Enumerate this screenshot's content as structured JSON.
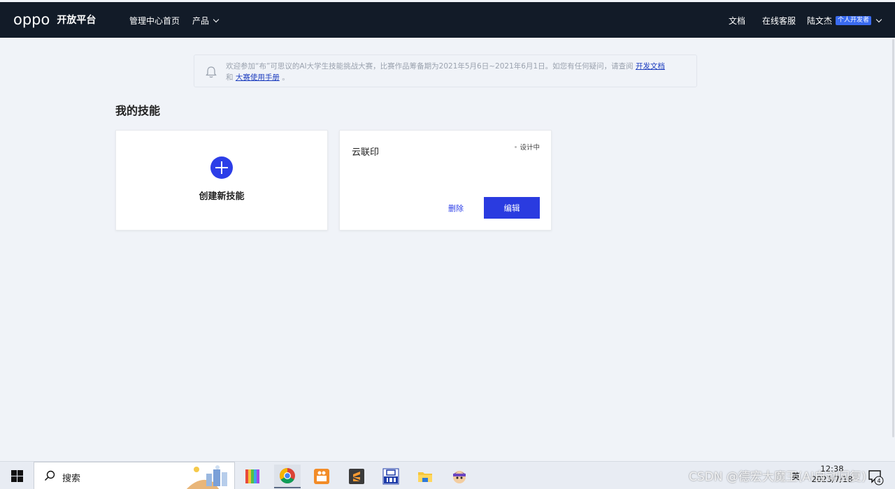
{
  "header": {
    "logo_text": "oppo",
    "platform_name": "开放平台",
    "nav": {
      "home": "管理中心首页",
      "products": "产品"
    },
    "right": {
      "docs": "文档",
      "support": "在线客服",
      "user_name": "陆文杰",
      "user_badge": "个人开发者"
    }
  },
  "notice": {
    "text_main": "欢迎参加“布”可思议的AI大学生技能挑战大赛，比赛作品筹备期为2021年5月6日~2021年6月1日。如您有任何疑问，请查阅",
    "link_docs": "开发文档",
    "and": "和",
    "link_manual": "大赛使用手册",
    "period": "。"
  },
  "main": {
    "section_title": "我的技能",
    "create_card": {
      "label": "创建新技能"
    },
    "skill_card": {
      "name": "云联印",
      "status": "设计中",
      "delete_label": "删除",
      "edit_label": "编辑"
    }
  },
  "taskbar": {
    "search_placeholder": "搜索",
    "clock_time": "12:38",
    "clock_date": "2023/7/18",
    "tray_lang": "英",
    "notification_count": "4",
    "apps": [
      "colors-app-icon",
      "chrome-icon",
      "shop-app-icon",
      "sublime-icon",
      "isp-icon",
      "file-explorer-icon",
      "game-app-icon"
    ]
  },
  "watermark": "CSDN @德宏大魔王(AI自动回复)",
  "colors": {
    "navbar": "#121b28",
    "accent": "#2a3be0",
    "page_bg": "#f0f3f8"
  }
}
